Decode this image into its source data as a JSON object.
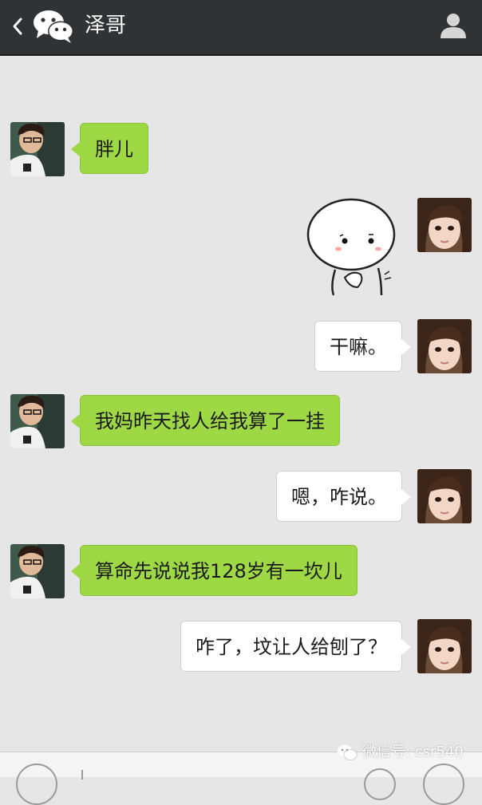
{
  "header": {
    "title": "泽哥",
    "back_icon": "chevron-left-icon",
    "logo_icon": "wechat-logo-icon",
    "profile_icon": "person-icon",
    "background": "#2f3335"
  },
  "messages": [
    {
      "side": "incoming",
      "avatar": "boy-avatar",
      "text": "胖儿"
    },
    {
      "side": "outgoing",
      "avatar": "girl-avatar",
      "sticker": "shy-face-sticker"
    },
    {
      "side": "outgoing",
      "avatar": "girl-avatar",
      "text": "干嘛。"
    },
    {
      "side": "incoming",
      "avatar": "boy-avatar",
      "text": "我妈昨天找人给我算了一挂"
    },
    {
      "side": "outgoing",
      "avatar": "girl-avatar",
      "text": "嗯，咋说。"
    },
    {
      "side": "incoming",
      "avatar": "boy-avatar",
      "text": "算命先说说我128岁有一坎儿"
    },
    {
      "side": "outgoing",
      "avatar": "girl-avatar",
      "text": "咋了，坟让人给刨了？"
    }
  ],
  "colors": {
    "incoming_bubble": "#9fd845",
    "outgoing_bubble": "#ffffff",
    "chat_background": "#e6e6e6"
  },
  "footer": {
    "voice_icon": "voice-icon",
    "emoji_icon": "emoji-icon",
    "more_icon": "plus-icon"
  },
  "watermark": {
    "text": "微信号: csr540",
    "icon": "wechat-logo-icon"
  }
}
